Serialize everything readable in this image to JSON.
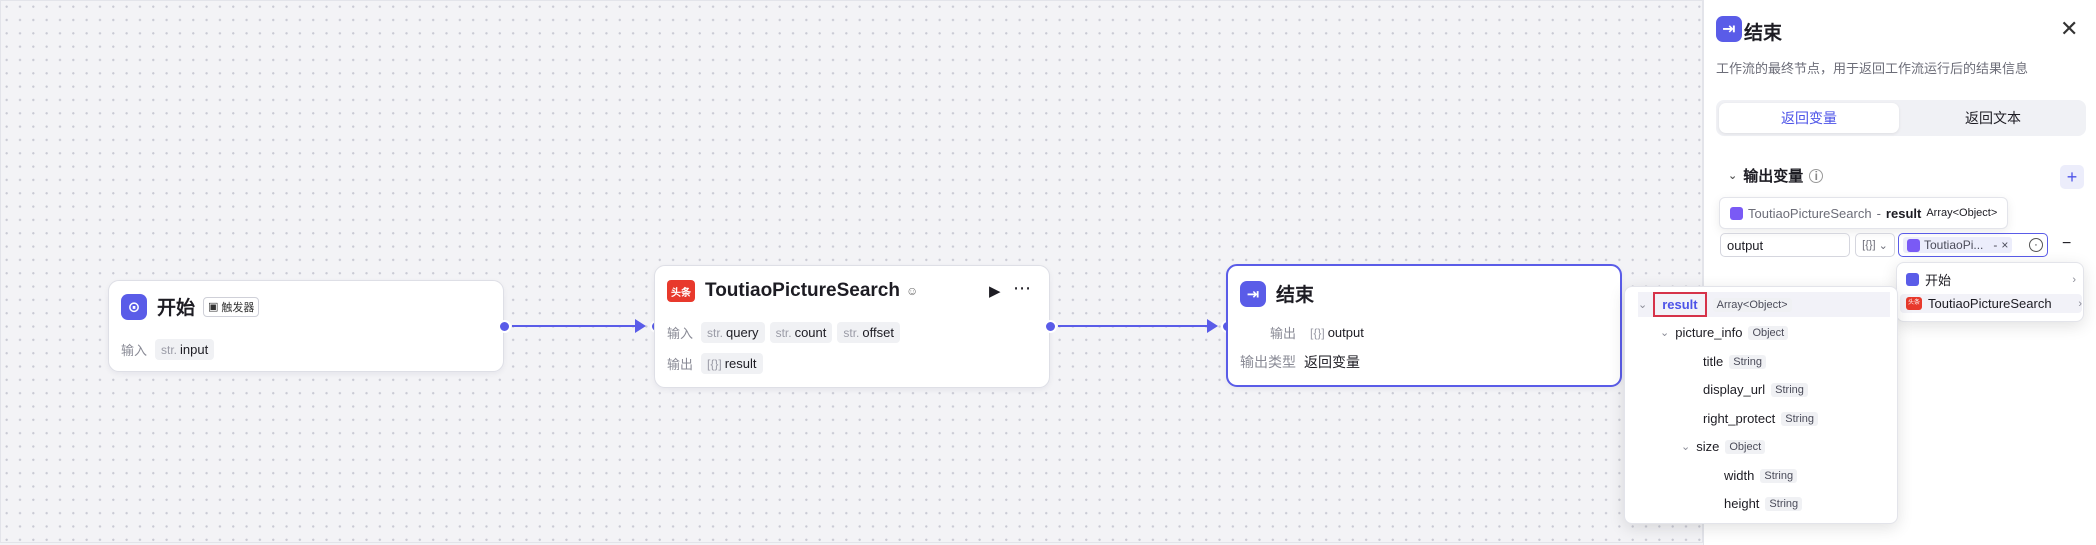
{
  "nodes": {
    "start": {
      "title": "开始",
      "trigger_label": "触发器",
      "input_label": "输入",
      "input_type": "str.",
      "input_name": "input"
    },
    "search": {
      "title": "ToutiaoPictureSearch",
      "logo_text": "头条",
      "input_label": "输入",
      "output_label": "输出",
      "inputs": [
        {
          "type": "str.",
          "name": "query"
        },
        {
          "type": "str.",
          "name": "count"
        },
        {
          "type": "str.",
          "name": "offset"
        }
      ],
      "output_type": "[{}]",
      "output_name": "result"
    },
    "end": {
      "title": "结束",
      "output_label": "输出",
      "output_type": "[{}]",
      "output_name": "output",
      "output_kind_label": "输出类型",
      "output_kind_value": "返回变量"
    }
  },
  "panel": {
    "title": "结束",
    "description": "工作流的最终节点，用于返回工作流运行后的结果信息",
    "tabs": [
      "返回变量",
      "返回文本"
    ],
    "section_title": "输出变量",
    "tooltip": {
      "node": "ToutiaoPictureSearch",
      "separator": "-",
      "var": "result",
      "type": "Array<Object>"
    },
    "var_name": "output",
    "var_type_label": "[{}]",
    "ref_chip": "ToutiaoPi...",
    "ref_chip_sep": "-",
    "ref_chip_close": "×"
  },
  "node_menu": [
    {
      "label": "开始"
    },
    {
      "label": "ToutiaoPictureSearch",
      "logo_text": "头条"
    }
  ],
  "var_tree": [
    {
      "name": "result",
      "type": "Array<Object>"
    },
    {
      "name": "picture_info",
      "type": "Object"
    },
    {
      "name": "title",
      "type": "String"
    },
    {
      "name": "display_url",
      "type": "String"
    },
    {
      "name": "right_protect",
      "type": "String"
    },
    {
      "name": "size",
      "type": "Object"
    },
    {
      "name": "width",
      "type": "String"
    },
    {
      "name": "height",
      "type": "String"
    }
  ],
  "colors": {
    "accent": "#5a5ce8",
    "brand_red": "#e8392c",
    "highlight_border": "#d6334a"
  }
}
